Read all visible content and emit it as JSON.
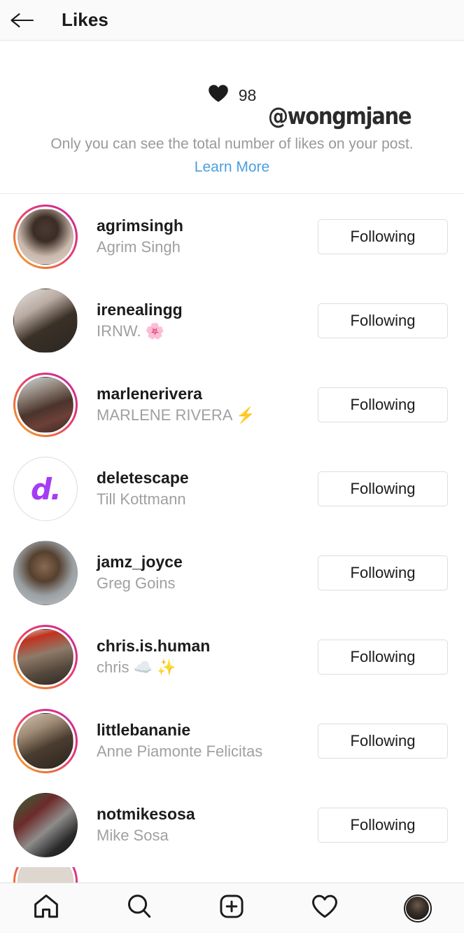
{
  "header": {
    "back_icon": "back-arrow-icon",
    "title": "Likes"
  },
  "info_banner": {
    "heart_icon": "heart-filled-icon",
    "like_count": "98",
    "watermark": "@wongmjane",
    "description": "Only you can see the total number of likes on your post.",
    "learn_more": "Learn More",
    "link_color": "#4a9fe0"
  },
  "list": {
    "rows": [
      {
        "username": "agrimsingh",
        "fullname": "Agrim Singh",
        "action": "Following",
        "has_story_ring": true,
        "avatar_kind": "photo"
      },
      {
        "username": "irenealingg",
        "fullname": "IRNW. 🌸",
        "action": "Following",
        "has_story_ring": false,
        "avatar_kind": "photo"
      },
      {
        "username": "marlenerivera",
        "fullname": "MARLENE RIVERA ⚡",
        "action": "Following",
        "has_story_ring": true,
        "avatar_kind": "photo"
      },
      {
        "username": "deletescape",
        "fullname": "Till Kottmann",
        "action": "Following",
        "has_story_ring": false,
        "avatar_kind": "logo",
        "avatar_text": "d."
      },
      {
        "username": "jamz_joyce",
        "fullname": "Greg Goins",
        "action": "Following",
        "has_story_ring": false,
        "avatar_kind": "photo"
      },
      {
        "username": "chris.is.human",
        "fullname": "chris ☁️ ✨",
        "action": "Following",
        "has_story_ring": true,
        "avatar_kind": "photo"
      },
      {
        "username": "littlebananie",
        "fullname": "Anne Piamonte Felicitas",
        "action": "Following",
        "has_story_ring": true,
        "avatar_kind": "photo"
      },
      {
        "username": "notmikesosa",
        "fullname": "Mike Sosa",
        "action": "Following",
        "has_story_ring": false,
        "avatar_kind": "photo"
      }
    ]
  },
  "bottom_nav": {
    "items": [
      {
        "name": "home-icon",
        "label": "Home"
      },
      {
        "name": "search-icon",
        "label": "Search"
      },
      {
        "name": "add-post-icon",
        "label": "New Post"
      },
      {
        "name": "activity-heart-icon",
        "label": "Activity"
      },
      {
        "name": "profile-avatar",
        "label": "Profile"
      }
    ],
    "active": "profile-avatar"
  },
  "theme": {
    "background": "#ffffff",
    "header_background": "#fafafa",
    "text_primary": "#1c1c1c",
    "text_secondary": "#a0a0a0",
    "border": "#dedede",
    "story_ring_gradient_start": "#f9b63a",
    "story_ring_gradient_end": "#c92bb7"
  }
}
